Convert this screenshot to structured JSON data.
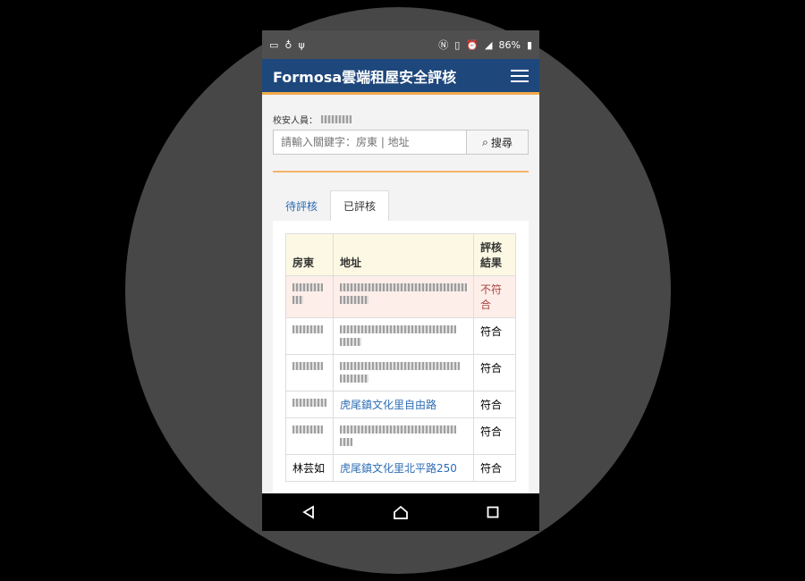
{
  "status_bar": {
    "battery": "86%"
  },
  "header": {
    "title": "Formosa雲端租屋安全評核"
  },
  "staff": {
    "label": "校安人員："
  },
  "search": {
    "placeholder": "請輸入關鍵字：房東 | 地址",
    "button_label": "搜尋"
  },
  "tabs": [
    {
      "label": "待評核"
    },
    {
      "label": "已評核"
    }
  ],
  "table": {
    "columns": [
      "房東",
      "地址",
      "評核結果"
    ],
    "rows": [
      {
        "landlord": "",
        "address": "",
        "result": "不符合"
      },
      {
        "landlord": "",
        "address": "",
        "result": "符合"
      },
      {
        "landlord": "",
        "address": "",
        "result": "符合"
      },
      {
        "landlord": "",
        "address": "虎尾鎮文化里自由路",
        "result": "符合"
      },
      {
        "landlord": "",
        "address": "",
        "result": "符合"
      },
      {
        "landlord": "林芸如",
        "address": "虎尾鎮文化里北平路250",
        "result": "符合"
      }
    ]
  },
  "colors": {
    "app_bar": "#1e477c",
    "accent": "#f0a94a",
    "link": "#2d6db5",
    "danger_text": "#a94442"
  }
}
